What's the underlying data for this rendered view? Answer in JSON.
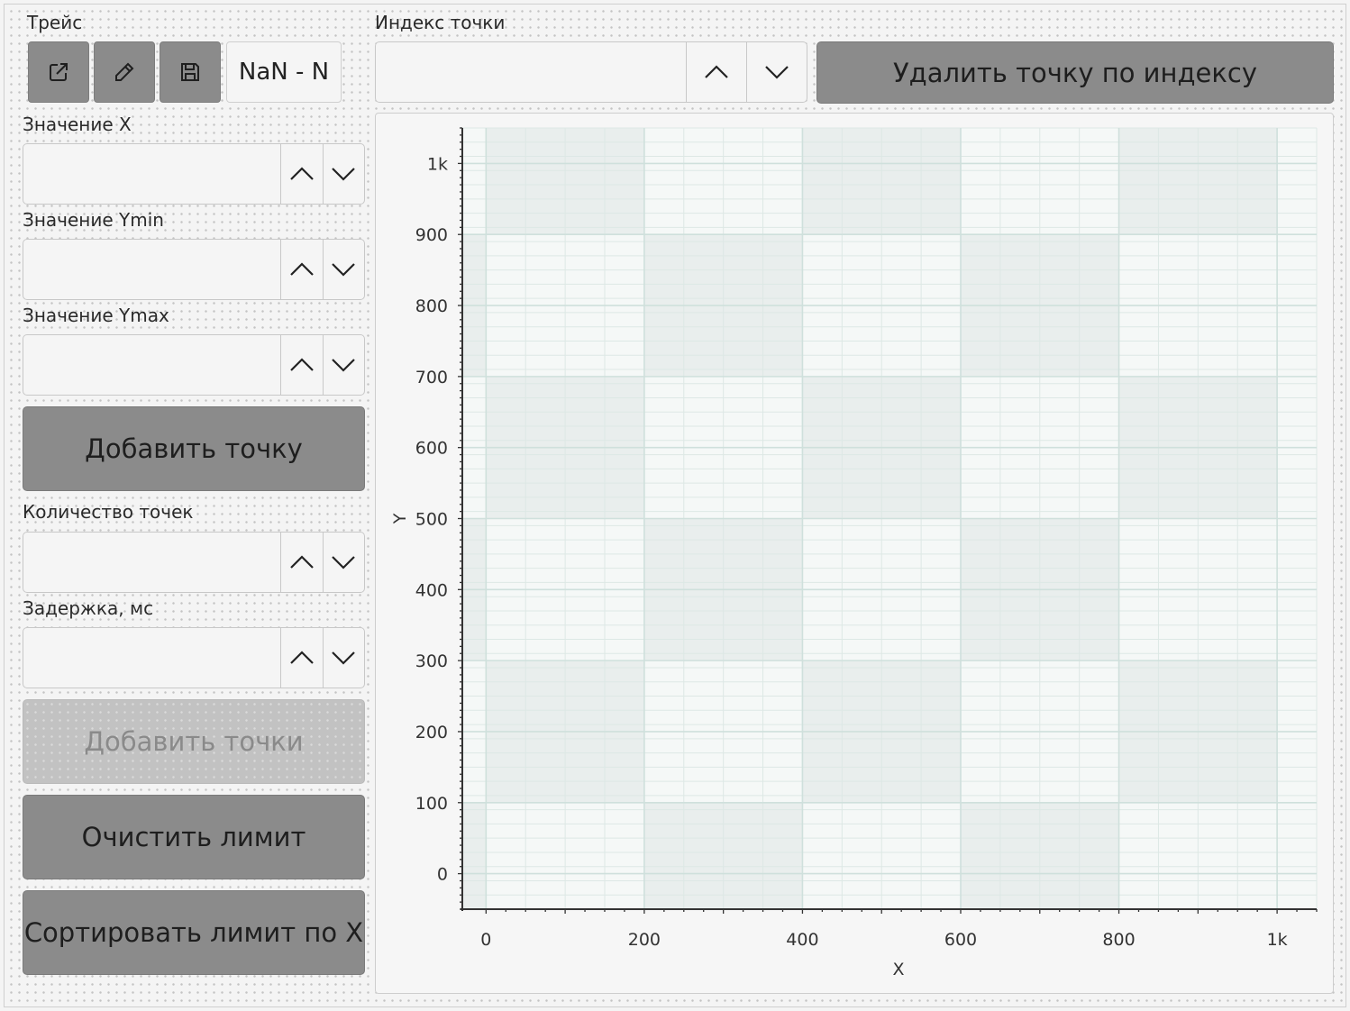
{
  "left_panel": {
    "trace_label": "Трейс",
    "trace_icons": [
      "external-link-icon",
      "pencil-icon",
      "save-icon"
    ],
    "trace_value": "NaN - N",
    "x_label": "Значение X",
    "x_value": "",
    "ymin_label": "Значение Ymin",
    "ymin_value": "",
    "ymax_label": "Значение Ymax",
    "ymax_value": "",
    "add_point_button": "Добавить точку",
    "count_label": "Количество точек",
    "count_value": "",
    "delay_label": "Задержка, мс",
    "delay_value": "",
    "add_points_button": "Добавить точки",
    "add_points_enabled": false,
    "clear_limit_button": "Очистить лимит",
    "sort_limit_button": "Сортировать лимит по X"
  },
  "top_bar": {
    "index_label": "Индекс точки",
    "index_value": "",
    "delete_button": "Удалить точку по индексу"
  },
  "colors": {
    "button_bg": "#8b8b8b",
    "disabled_bg": "#c2c2c2",
    "plot_bg": "#f5f8f7",
    "plot_band": "#e9eeed",
    "grid_major": "#cfe0dc",
    "grid_minor": "#dde8e5"
  },
  "chart_data": {
    "type": "scatter",
    "series": [],
    "xlabel": "X",
    "ylabel": "Y",
    "xlim": [
      -30,
      1050
    ],
    "ylim": [
      -50,
      1050
    ],
    "x_ticks": [
      0,
      200,
      400,
      600,
      800,
      1000
    ],
    "x_tick_labels": [
      "0",
      "200",
      "400",
      "600",
      "800",
      "1k"
    ],
    "y_ticks": [
      0,
      100,
      200,
      300,
      400,
      500,
      600,
      700,
      800,
      900,
      1000
    ],
    "y_tick_labels": [
      "0",
      "100",
      "200",
      "300",
      "400",
      "500",
      "600",
      "700",
      "800",
      "900",
      "1k"
    ],
    "grid": true
  }
}
